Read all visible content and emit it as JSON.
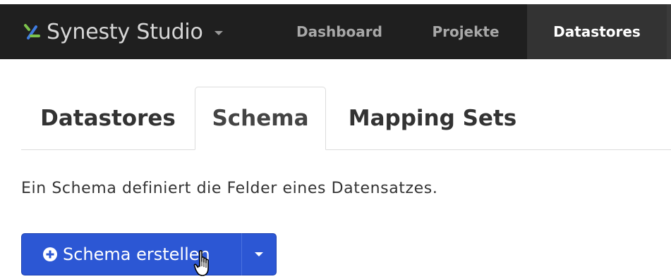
{
  "navbar": {
    "brand": "Synesty Studio",
    "brand_icon": "synesty-logo-icon",
    "items": [
      {
        "label": "Dashboard",
        "active": false
      },
      {
        "label": "Projekte",
        "active": false
      },
      {
        "label": "Datastores",
        "active": true
      }
    ]
  },
  "tabs": [
    {
      "label": "Datastores",
      "active": false
    },
    {
      "label": "Schema",
      "active": true
    },
    {
      "label": "Mapping Sets",
      "active": false
    }
  ],
  "description": "Ein Schema definiert die Felder eines Datensatzes.",
  "create_button": {
    "label": "Schema erstellen",
    "icon": "plus-circle-icon",
    "toggle_icon": "caret-down-icon"
  },
  "colors": {
    "navbar_bg": "#1f1f1f",
    "active_nav_bg": "#333333",
    "primary_button": "#2c57d4",
    "logo_green": "#7cc24c",
    "logo_blue": "#3f7be0"
  }
}
